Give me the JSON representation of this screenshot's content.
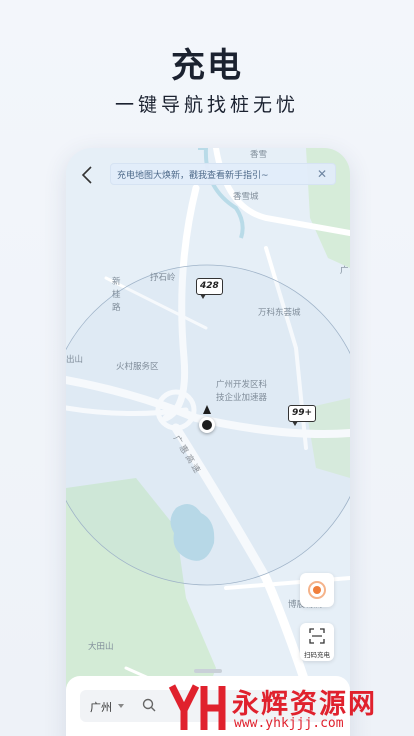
{
  "hero": {
    "title": "充电",
    "subtitle": "一键导航找桩无忧"
  },
  "tip": {
    "text": "充电地图大焕新，戳我查看新手指引~"
  },
  "map": {
    "labels": {
      "xiangxue": "香雪",
      "xiangxue_city": "香雪城",
      "huishiling": "抒石岭",
      "vanke": "万科东荟城",
      "huocun": "火村服务区",
      "incubator_1": "广州开发区科",
      "incubator_2": "技企业加速器",
      "bolan": "博展物流",
      "datianshan": "大田山",
      "edge_guang": "广",
      "edge_shan": "出山",
      "xingui_road": "新桂路",
      "expressway": "广 惠 高 速"
    },
    "markers": {
      "station_a": "428",
      "station_b": "99+"
    }
  },
  "controls": {
    "scan_label": "扫码充电"
  },
  "search": {
    "city": "广州",
    "placeholder": ""
  },
  "watermark": {
    "title": "永辉资源网",
    "url": "www.yhkjjj.com"
  },
  "colors": {
    "accent": "#f07f3c",
    "map_water": "#b9dbe8",
    "map_green": "#d6ecd9",
    "map_road": "#ffffff",
    "watermark": "#e0212d"
  }
}
